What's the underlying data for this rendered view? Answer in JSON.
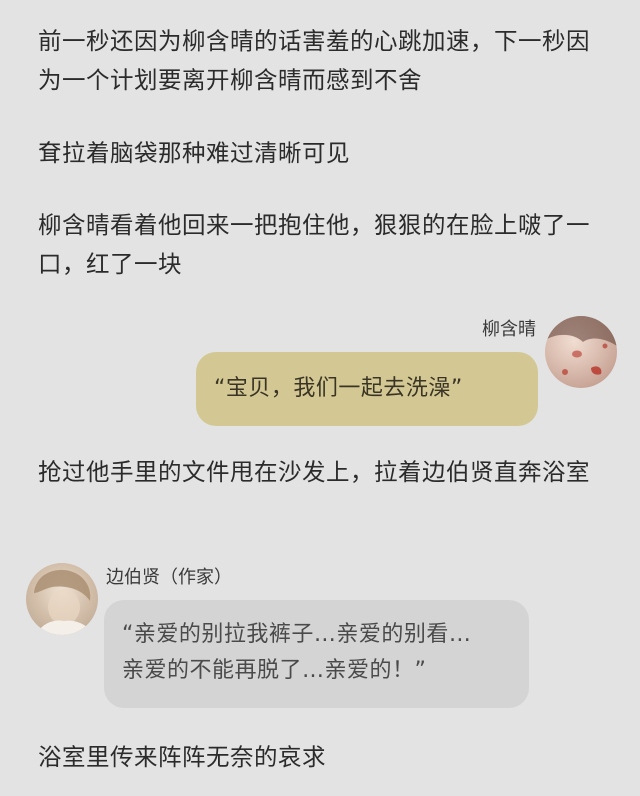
{
  "paragraphs": [
    "前一秒还因为柳含晴的话害羞的心跳加速，下一秒因为一个计划要离开柳含晴而感到不舍",
    "耷拉着脑袋那种难过清晰可见",
    "柳含晴看着他回来一把抱住他，狠狠的在脸上啵了一口，红了一块",
    "抢过他手里的文件甩在沙发上，拉着边伯贤直奔浴室",
    "浴室里传来阵阵无奈的哀求"
  ],
  "chat_right": {
    "name": "柳含晴",
    "message": "“宝贝，我们一起去洗澡”"
  },
  "chat_left": {
    "name": "边伯贤（作家）",
    "message_lines": [
      "“亲爱的别拉我裤子…亲爱的别看…",
      "亲爱的不能再脱了…亲爱的！”"
    ]
  }
}
